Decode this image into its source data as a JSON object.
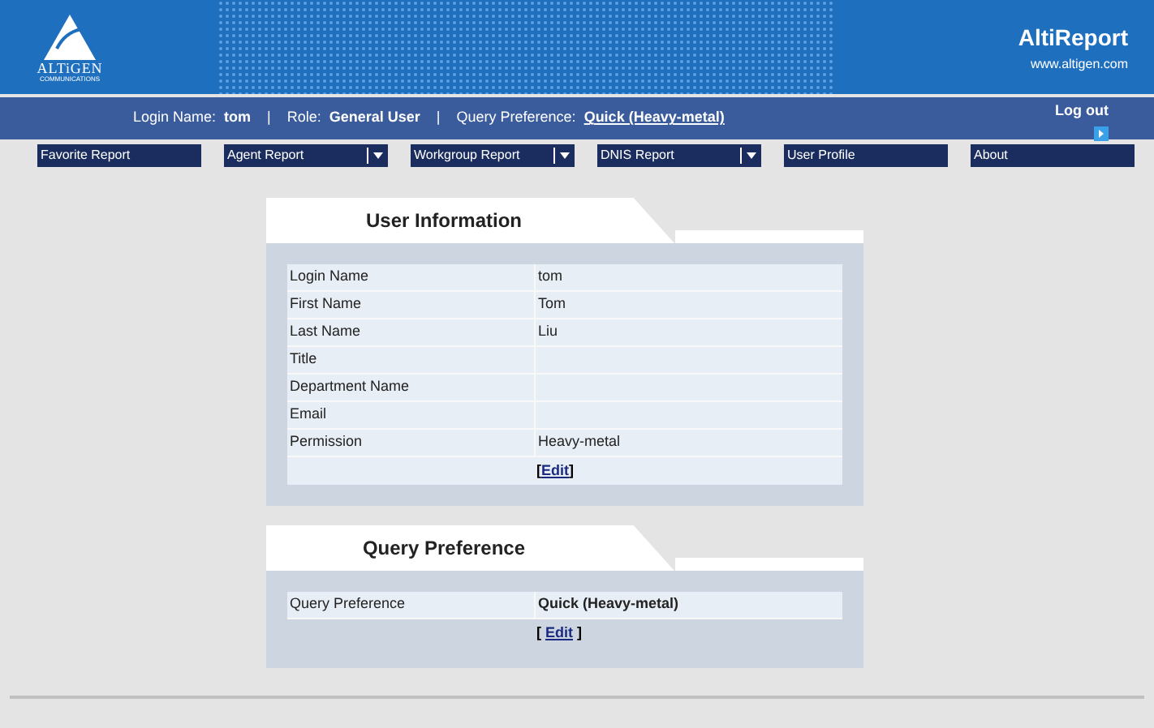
{
  "header": {
    "logo_name": "ALTiGEN",
    "logo_sub": "COMMUNICATIONS",
    "app_title": "AltiReport",
    "site": "www.altigen.com"
  },
  "info_bar": {
    "items": [
      {
        "label": "Login Name:",
        "value": "tom",
        "kind": "text"
      },
      {
        "label": "Role:",
        "value": "General User",
        "kind": "text"
      },
      {
        "label": "Query Preference:",
        "value": "Quick (Heavy-metal)",
        "kind": "link"
      }
    ],
    "separator": "|",
    "logout": "Log out"
  },
  "nav": [
    {
      "label": "Favorite Report",
      "kind": "link"
    },
    {
      "label": "Agent Report",
      "kind": "dropdown"
    },
    {
      "label": "Workgroup Report",
      "kind": "dropdown"
    },
    {
      "label": "DNIS Report",
      "kind": "dropdown"
    },
    {
      "label": "User Profile",
      "kind": "link"
    },
    {
      "label": "About",
      "kind": "link"
    }
  ],
  "user_info": {
    "title": "User Information",
    "rows": [
      {
        "label": "Login Name",
        "value": "tom"
      },
      {
        "label": "First Name",
        "value": "Tom"
      },
      {
        "label": "Last Name",
        "value": "Liu"
      },
      {
        "label": "Title",
        "value": ""
      },
      {
        "label": "Department Name",
        "value": ""
      },
      {
        "label": "Email",
        "value": ""
      },
      {
        "label": "Permission",
        "value": "Heavy-metal"
      }
    ],
    "edit": {
      "open": "[",
      "label": "Edit",
      "close": "]"
    }
  },
  "query_pref": {
    "title": "Query Preference",
    "rows": [
      {
        "label": "Query Preference",
        "value": "Quick (Heavy-metal)"
      }
    ],
    "edit": {
      "open": "[ ",
      "label": "Edit",
      "close": " ]"
    }
  }
}
